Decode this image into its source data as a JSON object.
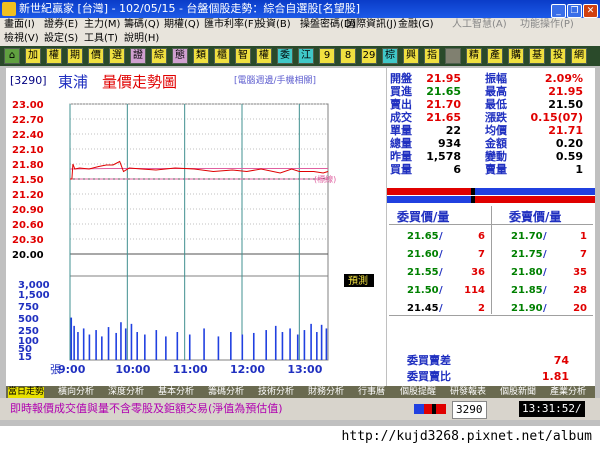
{
  "window": {
    "title": "新世紀贏家 [台灣] - 102/05/15 - 台盤個股走勢：綜合自選股[名望股]"
  },
  "menu": {
    "row1": [
      "畫面(I)",
      "證券(E)",
      "主力(M)",
      "籌碼(Q)",
      "期權(Q)",
      "匯市利率(F)",
      "投資(B)",
      "操盤密碼(D)",
      "國際資訊(J)",
      "金融(G)",
      "人工智慧(A)",
      "功能操作(P)"
    ],
    "row2": [
      "檢視(V)",
      "設定(S)",
      "工具(T)",
      "說明(H)"
    ]
  },
  "toolbar": {
    "buttons": [
      "⌂",
      "加",
      "權",
      "期",
      "價",
      "選",
      "證",
      "綜",
      "態",
      "類",
      "櫃",
      "智",
      "權",
      "委",
      "江",
      "9",
      "8",
      "29",
      "棕",
      "興",
      "指",
      "",
      "精",
      "產",
      "購",
      "基",
      "投",
      "網"
    ]
  },
  "chart": {
    "code": "[3290]",
    "name": "東浦",
    "title": "量價走勢圖",
    "note": "[電腦週邊/手機相關]",
    "ref_label": "(標線)",
    "pred_label": "預測",
    "volume_unit": "張"
  },
  "chart_data": {
    "type": "line",
    "price_ticks": [
      "23.00",
      "22.70",
      "22.40",
      "22.10",
      "21.80",
      "21.50",
      "21.20",
      "20.90",
      "20.60",
      "20.30",
      "20.00"
    ],
    "volume_ticks": [
      "3,000",
      "1,500",
      "750",
      "500",
      "250",
      "100",
      "50",
      "15"
    ],
    "time_ticks": [
      "9:00",
      "10:00",
      "11:00",
      "12:00",
      "13:00"
    ],
    "price_ylim": [
      20.0,
      23.0
    ],
    "reference_price": 21.5,
    "price_series": [
      {
        "t": 0,
        "p": 21.5
      },
      {
        "t": 2,
        "p": 21.5
      },
      {
        "t": 3,
        "p": 21.8
      },
      {
        "t": 5,
        "p": 21.7
      },
      {
        "t": 10,
        "p": 21.72
      },
      {
        "t": 20,
        "p": 21.7
      },
      {
        "t": 30,
        "p": 21.75
      },
      {
        "t": 38,
        "p": 21.78
      },
      {
        "t": 45,
        "p": 21.78
      },
      {
        "t": 52,
        "p": 21.85
      },
      {
        "t": 56,
        "p": 21.65
      },
      {
        "t": 62,
        "p": 21.72
      },
      {
        "t": 75,
        "p": 21.7
      },
      {
        "t": 90,
        "p": 21.68
      },
      {
        "t": 110,
        "p": 21.72
      },
      {
        "t": 130,
        "p": 21.7
      },
      {
        "t": 150,
        "p": 21.65
      },
      {
        "t": 170,
        "p": 21.68
      },
      {
        "t": 185,
        "p": 21.65
      },
      {
        "t": 200,
        "p": 21.7
      },
      {
        "t": 220,
        "p": 21.62
      },
      {
        "t": 232,
        "p": 21.7
      },
      {
        "t": 240,
        "p": 21.65
      },
      {
        "t": 255,
        "p": 21.65
      },
      {
        "t": 265,
        "p": 21.62
      },
      {
        "t": 270,
        "p": 21.65
      }
    ],
    "avg_series": [
      {
        "t": 0,
        "p": 21.7
      },
      {
        "t": 40,
        "p": 21.71
      },
      {
        "t": 100,
        "p": 21.71
      },
      {
        "t": 180,
        "p": 21.71
      },
      {
        "t": 270,
        "p": 21.71
      }
    ],
    "volumes": [
      {
        "t": 1,
        "v": 100
      },
      {
        "t": 4,
        "v": 40
      },
      {
        "t": 8,
        "v": 20
      },
      {
        "t": 14,
        "v": 30
      },
      {
        "t": 20,
        "v": 15
      },
      {
        "t": 27,
        "v": 25
      },
      {
        "t": 33,
        "v": 12
      },
      {
        "t": 40,
        "v": 35
      },
      {
        "t": 48,
        "v": 18
      },
      {
        "t": 53,
        "v": 60
      },
      {
        "t": 58,
        "v": 30
      },
      {
        "t": 64,
        "v": 50
      },
      {
        "t": 70,
        "v": 20
      },
      {
        "t": 78,
        "v": 15
      },
      {
        "t": 90,
        "v": 25
      },
      {
        "t": 100,
        "v": 12
      },
      {
        "t": 112,
        "v": 20
      },
      {
        "t": 125,
        "v": 15
      },
      {
        "t": 140,
        "v": 30
      },
      {
        "t": 155,
        "v": 12
      },
      {
        "t": 168,
        "v": 20
      },
      {
        "t": 180,
        "v": 15
      },
      {
        "t": 192,
        "v": 18
      },
      {
        "t": 205,
        "v": 25
      },
      {
        "t": 215,
        "v": 40
      },
      {
        "t": 222,
        "v": 20
      },
      {
        "t": 230,
        "v": 30
      },
      {
        "t": 238,
        "v": 15
      },
      {
        "t": 245,
        "v": 25
      },
      {
        "t": 252,
        "v": 50
      },
      {
        "t": 258,
        "v": 20
      },
      {
        "t": 263,
        "v": 45
      },
      {
        "t": 268,
        "v": 30
      }
    ],
    "colors": {
      "price": "#e00000",
      "avg": "#e060a0",
      "volume": "#2040e0",
      "grid": "#c0c0c0"
    }
  },
  "quote": {
    "rows": [
      {
        "l": "開盤",
        "v": "21.95",
        "vc": "red",
        "l2": "振幅",
        "v2": "2.09%",
        "v2c": "red"
      },
      {
        "l": "買進",
        "v": "21.65",
        "vc": "green",
        "l2": "最高",
        "v2": "21.95",
        "v2c": "red"
      },
      {
        "l": "賣出",
        "v": "21.70",
        "vc": "red",
        "l2": "最低",
        "v2": "21.50",
        "v2c": "black"
      },
      {
        "l": "成交",
        "v": "21.65",
        "vc": "red",
        "l2": "漲跌",
        "v2": "0.15(07)",
        "v2c": "red"
      },
      {
        "l": "單量",
        "v": "22",
        "vc": "black",
        "l2": "均價",
        "v2": "21.71",
        "v2c": "red"
      },
      {
        "l": "總量",
        "v": "934",
        "vc": "black",
        "l2": "金額",
        "v2": "0.20",
        "v2c": "black"
      },
      {
        "l": "昨量",
        "v": "1,578",
        "vc": "black",
        "l2": "變動",
        "v2": "0.59",
        "v2c": "black"
      },
      {
        "l": "買量",
        "v": "6",
        "vc": "black",
        "l2": "賣量",
        "v2": "1",
        "v2c": "black"
      }
    ]
  },
  "orderbook": {
    "bid_header": "委買價/量",
    "ask_header": "委賣價/量",
    "bids": [
      {
        "p": "21.65",
        "q": "6"
      },
      {
        "p": "21.60",
        "q": "7"
      },
      {
        "p": "21.55",
        "q": "36"
      },
      {
        "p": "21.50",
        "q": "114"
      },
      {
        "p": "21.45",
        "q": "2"
      }
    ],
    "asks": [
      {
        "p": "21.70",
        "q": "1"
      },
      {
        "p": "21.75",
        "q": "7"
      },
      {
        "p": "21.80",
        "q": "35"
      },
      {
        "p": "21.85",
        "q": "28"
      },
      {
        "p": "21.90",
        "q": "20"
      }
    ],
    "diff_label": "委買賣差",
    "diff_value": "74",
    "ratio_label": "委買賣比",
    "ratio_value": "1.81"
  },
  "tabs": [
    "當日走勢",
    "橫向分析",
    "深度分析",
    "基本分析",
    "籌碼分析",
    "技術分析",
    "財務分析",
    "行事曆",
    "個股提醒",
    "研發報表",
    "個股新聞",
    "產業分析"
  ],
  "status": {
    "message": "即時報價成交值與量不含零股及鉅額交易(淨值為預估值)",
    "code": "3290",
    "time": "13:31:52/"
  },
  "url": "http://kujd3268.pixnet.net/album"
}
